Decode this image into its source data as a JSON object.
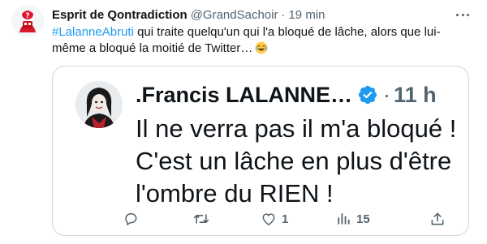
{
  "tweet": {
    "author_name": "Esprit de Qontradiction",
    "handle": "@GrandSachoir",
    "separator": "·",
    "time": "19 min",
    "hashtag": "#LalanneAbruti",
    "text": " qui traite quelqu'un qui l'a bloqué de lâche, alors que lui-même a bloqué la moitié de Twitter…",
    "emoji": "😂"
  },
  "quoted_tweet": {
    "author_name": ".Francis LALANNE…",
    "separator": "·",
    "time": "11 h",
    "text": "Il ne verra pas il m'a bloqué ! C'est un lâche en plus d'être l'ombre du RIEN !",
    "actions": {
      "reply_count": "",
      "retweet_count": "",
      "like_count": "1",
      "views_count": "15",
      "share_count": ""
    }
  },
  "colors": {
    "text": "#0f1419",
    "secondary": "#536471",
    "link": "#1d9bf0",
    "border": "#cfd9de",
    "verified": "#1d9bf0"
  }
}
